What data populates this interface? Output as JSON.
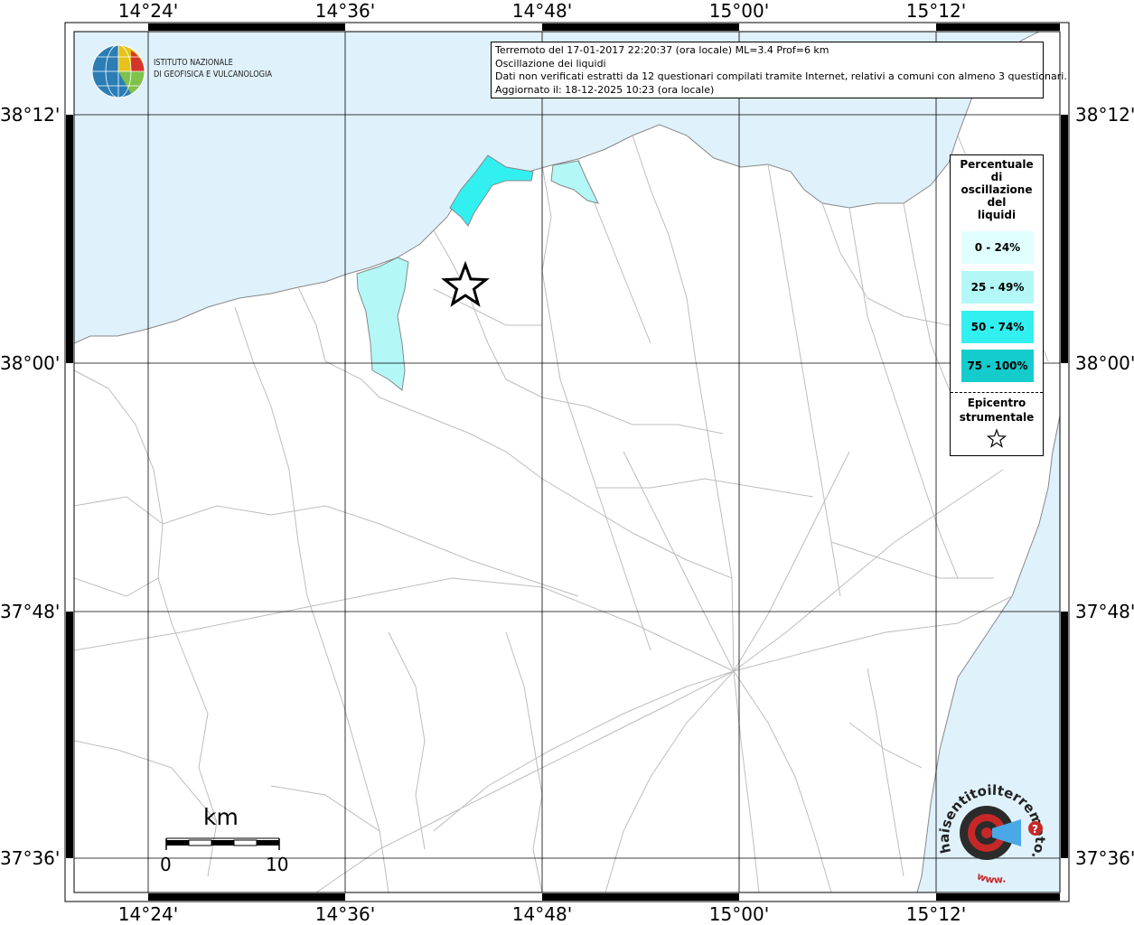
{
  "lon_labels": [
    "14°24'",
    "14°36'",
    "14°48'",
    "15°00'",
    "15°12'"
  ],
  "lat_labels": [
    "38°12'",
    "38°00'",
    "37°48'",
    "37°36'"
  ],
  "info": {
    "line1": "Terremoto del 17-01-2017 22:20:37 (ora locale) ML=3.4 Prof=6 km",
    "line2": "Oscillazione dei liquidi",
    "line3": "Dati non verificati estratti da 12 questionari compilati tramite Internet, relativi a comuni con almeno 3 questionari.",
    "line4": "Aggiornato il: 18-12-2025 10:23 (ora locale)"
  },
  "ingv": {
    "line1": "ISTITUTO NAZIONALE",
    "line2": "DI GEOFISICA E VULCANOLOGIA"
  },
  "legend": {
    "title_lines": [
      "Percentuale",
      "di",
      "oscillazione",
      "del",
      "liquidi"
    ],
    "items": [
      {
        "label": "0 - 24%",
        "color": "#e0ffff"
      },
      {
        "label": "25 - 49%",
        "color": "#b3f7f7"
      },
      {
        "label": "50 - 74%",
        "color": "#33f0f0"
      },
      {
        "label": "75 - 100%",
        "color": "#14cccc"
      }
    ],
    "epicentre_lines": [
      "Epicentro",
      "strumentale"
    ]
  },
  "scale": {
    "title": "km",
    "start": "0",
    "end": "10"
  },
  "logo_hst": {
    "text_main": "haisentitoilterremoto.it",
    "text_sub": "www."
  },
  "colors": {
    "sea": "#dff1fb",
    "land": "#ffffff",
    "borders": "#b8b8b8",
    "grid": "#000000"
  }
}
